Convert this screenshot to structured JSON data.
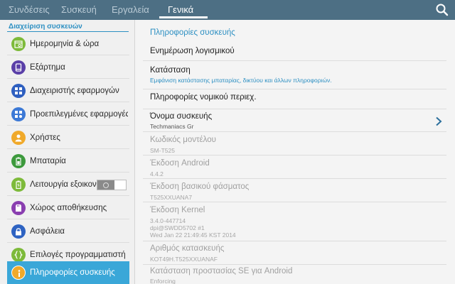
{
  "tabs": [
    {
      "label": "Συνδέσεις",
      "active": false
    },
    {
      "label": "Συσκευή",
      "active": false
    },
    {
      "label": "Εργαλεία",
      "active": false
    },
    {
      "label": "Γενικά",
      "active": true
    }
  ],
  "search_icon": "search-icon",
  "sidebar": {
    "section_title": "Διαχείριση συσκευών",
    "items": [
      {
        "label": "Ημερομηνία & ώρα",
        "icon": "calendar-clock-icon",
        "color": "#7dba3a"
      },
      {
        "label": "Εξάρτημα",
        "icon": "accessory-icon",
        "color": "#5a3fa8"
      },
      {
        "label": "Διαχειριστής εφαρμογών",
        "icon": "app-grid-icon",
        "color": "#2e5fc0"
      },
      {
        "label": "Προεπιλεγμένες εφαρμογές",
        "icon": "default-apps-icon",
        "color": "#3c79d6"
      },
      {
        "label": "Χρήστες",
        "icon": "users-icon",
        "color": "#f0a92a"
      },
      {
        "label": "Μπαταρία",
        "icon": "battery-icon",
        "color": "#3d9a3d"
      },
      {
        "label": "Λειτουργία εξοικονόμησης ενέργειας",
        "icon": "power-saving-icon",
        "color": "#7dba3a",
        "toggle": true,
        "toggle_on": false
      },
      {
        "label": "Χώρος αποθήκευσης",
        "icon": "storage-icon",
        "color": "#8a3fb0"
      },
      {
        "label": "Ασφάλεια",
        "icon": "lock-icon",
        "color": "#2e63c2"
      },
      {
        "label": "Επιλογές προγραμματιστή",
        "icon": "developer-braces-icon",
        "color": "#7dba3a"
      },
      {
        "label": "Πληροφορίες συσκευής",
        "icon": "info-icon",
        "color": "#f0a92a",
        "selected": true
      }
    ]
  },
  "main": {
    "header": "Πληροφορίες συσκευής",
    "rows": [
      {
        "title": "Ενημέρωση λογισμικού"
      },
      {
        "title": "Κατάσταση",
        "subtitle": "Εμφάνιση κατάστασης μπαταρίας, δικτύου και άλλων πληροφοριών."
      },
      {
        "title": "Πληροφορίες νομικού περιεχ."
      },
      {
        "title": "Όνομα συσκευής",
        "subtitle": "Techmaniacs Gr",
        "chevron": true
      },
      {
        "title": "Κωδικός μοντέλου",
        "subtitle": "SM-T525",
        "disabled": true
      },
      {
        "title": "Έκδοση Android",
        "subtitle": "4.4.2",
        "disabled": true
      },
      {
        "title": "Έκδοση βασικού φάσματος",
        "subtitle": "T525XXUANA7",
        "disabled": true
      },
      {
        "title": "Έκδοση Kernel",
        "subtitle_lines": [
          "3.4.0-447714",
          "dpi@SWDD5702 #1",
          "Wed Jan 22 21:49:45 KST 2014"
        ],
        "disabled": true
      },
      {
        "title": "Αριθμός κατασκευής",
        "subtitle": "KOT49H.T525XXUANAF",
        "disabled": true
      },
      {
        "title": "Κατάσταση προστασίας SE για Android",
        "subtitle": "Enforcing",
        "disabled": true
      }
    ]
  },
  "colors": {
    "topbar": "#4d6f84",
    "accent": "#2c8fc2",
    "selected_item": "#3aa7d8"
  }
}
